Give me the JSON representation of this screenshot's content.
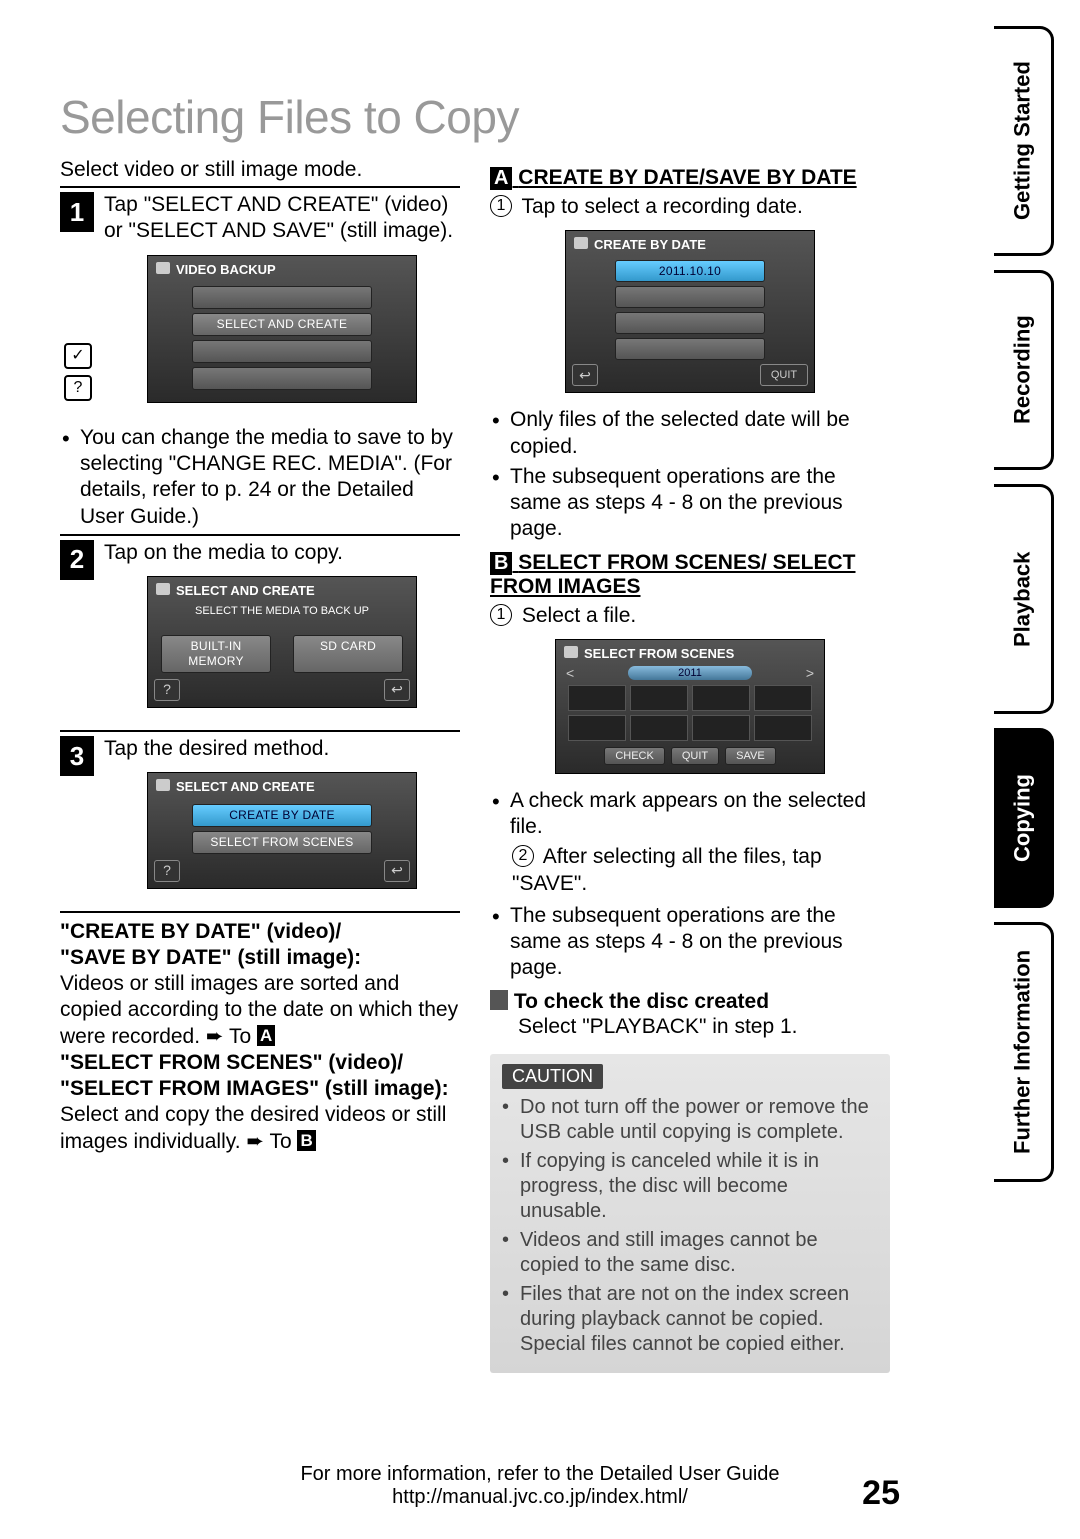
{
  "title": "Selecting Files to Copy",
  "intro": "Select video or still image mode.",
  "steps": {
    "s1": {
      "num": "1",
      "text_a": "Tap \"SELECT AND CREATE\" (video)",
      "text_b": "or \"SELECT AND SAVE\" (still image)."
    },
    "s2": {
      "num": "2",
      "text": "Tap on the media to copy."
    },
    "s3": {
      "num": "3",
      "text": "Tap the desired method."
    }
  },
  "screen1": {
    "title": "VIDEO BACKUP",
    "rows": [
      "",
      "SELECT AND CREATE",
      "",
      ""
    ],
    "side1": "✓",
    "side2": "?"
  },
  "bullet_s1": "You can change the media to save to by selecting \"CHANGE REC. MEDIA\". (For details, refer to p. 24 or the Detailed User Guide.)",
  "screen2": {
    "title": "SELECT AND CREATE",
    "subtitle": "SELECT THE MEDIA TO BACK UP",
    "left": "BUILT-IN MEMORY",
    "right": "SD CARD",
    "bl": "?",
    "br": "↩"
  },
  "screen3": {
    "title": "SELECT AND CREATE",
    "row1": "CREATE BY DATE",
    "row2": "SELECT FROM SCENES",
    "bl": "?",
    "br": "↩"
  },
  "methods": {
    "h1a": "\"CREATE BY DATE\" (video)/",
    "h1b": "\"SAVE BY DATE\" (still image):",
    "p1a": "Videos or still images are sorted and copied according to the date on which they were recorded. ",
    "p1b": "To",
    "h2a": "\"SELECT FROM SCENES\" (video)/",
    "h2b": "\"SELECT FROM IMAGES\" (still image):",
    "p2a": "Select and copy the desired videos or still images individually. ",
    "p2b": "To"
  },
  "right": {
    "headA_badge": "A",
    "headA_text": "CREATE BY DATE/SAVE BY DATE",
    "r1_num": "1",
    "r1_text": "Tap to select a recording date.",
    "screenA": {
      "title": "CREATE BY DATE",
      "date_sel": "2011.10.10",
      "quit": "QUIT",
      "back": "↩"
    },
    "bulA1": "Only files of the selected date will be copied.",
    "bulA2": "The subsequent operations are the same as steps 4 - 8 on the previous page.",
    "headB_badge": "B",
    "headB_text": "SELECT FROM SCENES/ SELECT FROM IMAGES",
    "rB1_num": "1",
    "rB1_text": "Select a file.",
    "screenB": {
      "title": "SELECT FROM SCENES",
      "year": "2011",
      "check": "CHECK",
      "quit": "QUIT",
      "save": "SAVE"
    },
    "bulB1": "A check mark appears on the selected file.",
    "rB2_num": "2",
    "rB2_text": "After selecting all the files, tap \"SAVE\".",
    "bulB2": "The subsequent operations are the same as steps 4 - 8 on the previous page.",
    "check_head": "To check the disc created",
    "check_text": "Select \"PLAYBACK\" in step 1."
  },
  "caution": {
    "label": "CAUTION",
    "items": [
      "Do not turn off the power or remove the USB cable until copying is complete.",
      "If copying is canceled while it is in progress, the disc will become unusable.",
      "Videos and still images cannot be copied to the same disc.",
      "Files that are not on the index screen during playback cannot be copied. Special files cannot be copied either."
    ]
  },
  "tabs": [
    "Getting Started",
    "Recording",
    "Playback",
    "Copying",
    "Further Information"
  ],
  "footer": {
    "line1": "For more information, refer to the Detailed User Guide",
    "line2": "http://manual.jvc.co.jp/index.html/",
    "page": "25"
  },
  "badges": {
    "A": "A",
    "B": "B",
    "blk": "■"
  },
  "arrow": "➨"
}
